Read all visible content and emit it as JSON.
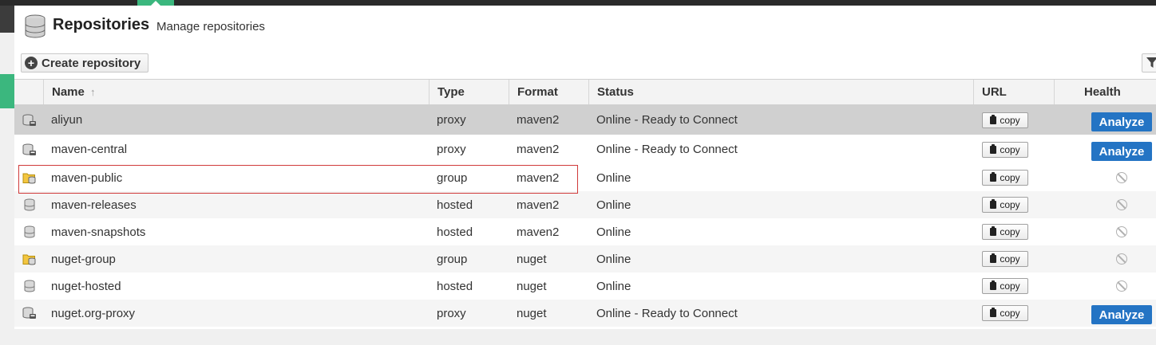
{
  "header": {
    "title": "Repositories",
    "subtitle": "Manage repositories"
  },
  "toolbar": {
    "create_label": "Create repository"
  },
  "columns": {
    "name": "Name",
    "type": "Type",
    "format": "Format",
    "status": "Status",
    "url": "URL",
    "health": "Health check"
  },
  "sort_indicator": "↑",
  "copy_label": "copy",
  "analyze_label": "Analyze",
  "rows": [
    {
      "name": "aliyun",
      "type": "proxy",
      "format": "maven2",
      "status": "Online - Ready to Connect",
      "icon": "proxy-repo-icon",
      "health": "analyze"
    },
    {
      "name": "maven-central",
      "type": "proxy",
      "format": "maven2",
      "status": "Online - Ready to Connect",
      "icon": "proxy-repo-icon",
      "health": "analyze"
    },
    {
      "name": "maven-public",
      "type": "group",
      "format": "maven2",
      "status": "Online",
      "icon": "group-repo-icon",
      "health": "none"
    },
    {
      "name": "maven-releases",
      "type": "hosted",
      "format": "maven2",
      "status": "Online",
      "icon": "hosted-repo-icon",
      "health": "none"
    },
    {
      "name": "maven-snapshots",
      "type": "hosted",
      "format": "maven2",
      "status": "Online",
      "icon": "hosted-repo-icon",
      "health": "none"
    },
    {
      "name": "nuget-group",
      "type": "group",
      "format": "nuget",
      "status": "Online",
      "icon": "group-repo-icon",
      "health": "none"
    },
    {
      "name": "nuget-hosted",
      "type": "hosted",
      "format": "nuget",
      "status": "Online",
      "icon": "hosted-repo-icon",
      "health": "none"
    },
    {
      "name": "nuget.org-proxy",
      "type": "proxy",
      "format": "nuget",
      "status": "Online - Ready to Connect",
      "icon": "proxy-repo-icon",
      "health": "analyze"
    }
  ],
  "colors": {
    "accent_green": "#3bb77e",
    "analyze_blue": "#2474c4",
    "selected_row": "#d0d0d0",
    "highlight_border": "#d03a3a"
  }
}
